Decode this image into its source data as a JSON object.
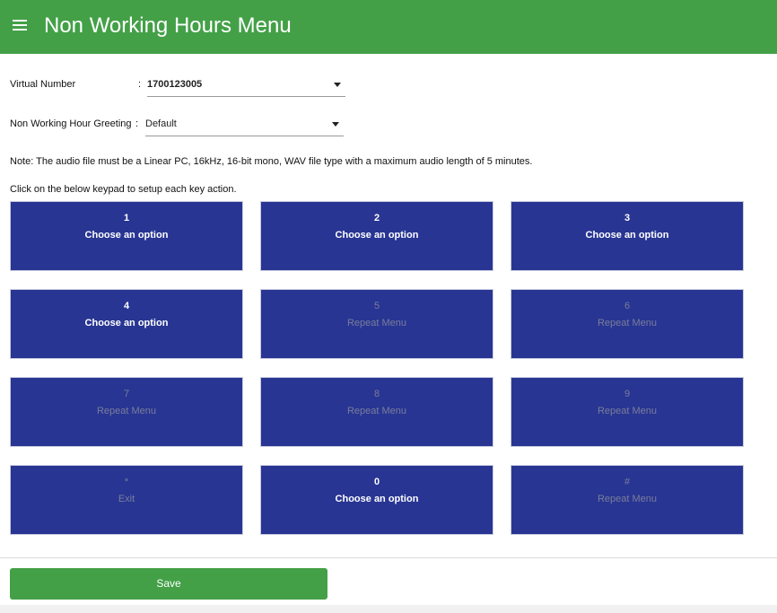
{
  "header": {
    "title": "Non Working Hours Menu",
    "menu_icon": "hamburger-menu-icon",
    "background_color": "#43a047"
  },
  "form": {
    "virtual_number": {
      "label": "Virtual Number",
      "separator": ":",
      "value": "1700123005"
    },
    "greeting": {
      "label": "Non Working Hour Greeting",
      "separator": ":",
      "value": "Default"
    },
    "note": "Note: The audio file must be a Linear PC, 16kHz, 16-bit mono, WAV file type with a maximum audio length of 5 minutes.",
    "instruction": "Click on the below keypad to setup each key action."
  },
  "keypad": {
    "key_color": "#283593",
    "keys": [
      {
        "key": "1",
        "action": "Choose an option",
        "active": true
      },
      {
        "key": "2",
        "action": "Choose an option",
        "active": true
      },
      {
        "key": "3",
        "action": "Choose an option",
        "active": true
      },
      {
        "key": "4",
        "action": "Choose an option",
        "active": true
      },
      {
        "key": "5",
        "action": "Repeat Menu",
        "active": false
      },
      {
        "key": "6",
        "action": "Repeat Menu",
        "active": false
      },
      {
        "key": "7",
        "action": "Repeat Menu",
        "active": false
      },
      {
        "key": "8",
        "action": "Repeat Menu",
        "active": false
      },
      {
        "key": "9",
        "action": "Repeat Menu",
        "active": false
      },
      {
        "key": "*",
        "action": "Exit",
        "active": false
      },
      {
        "key": "0",
        "action": "Choose an option",
        "active": true
      },
      {
        "key": "#",
        "action": "Repeat Menu",
        "active": false
      }
    ]
  },
  "footer": {
    "save_label": "Save"
  }
}
